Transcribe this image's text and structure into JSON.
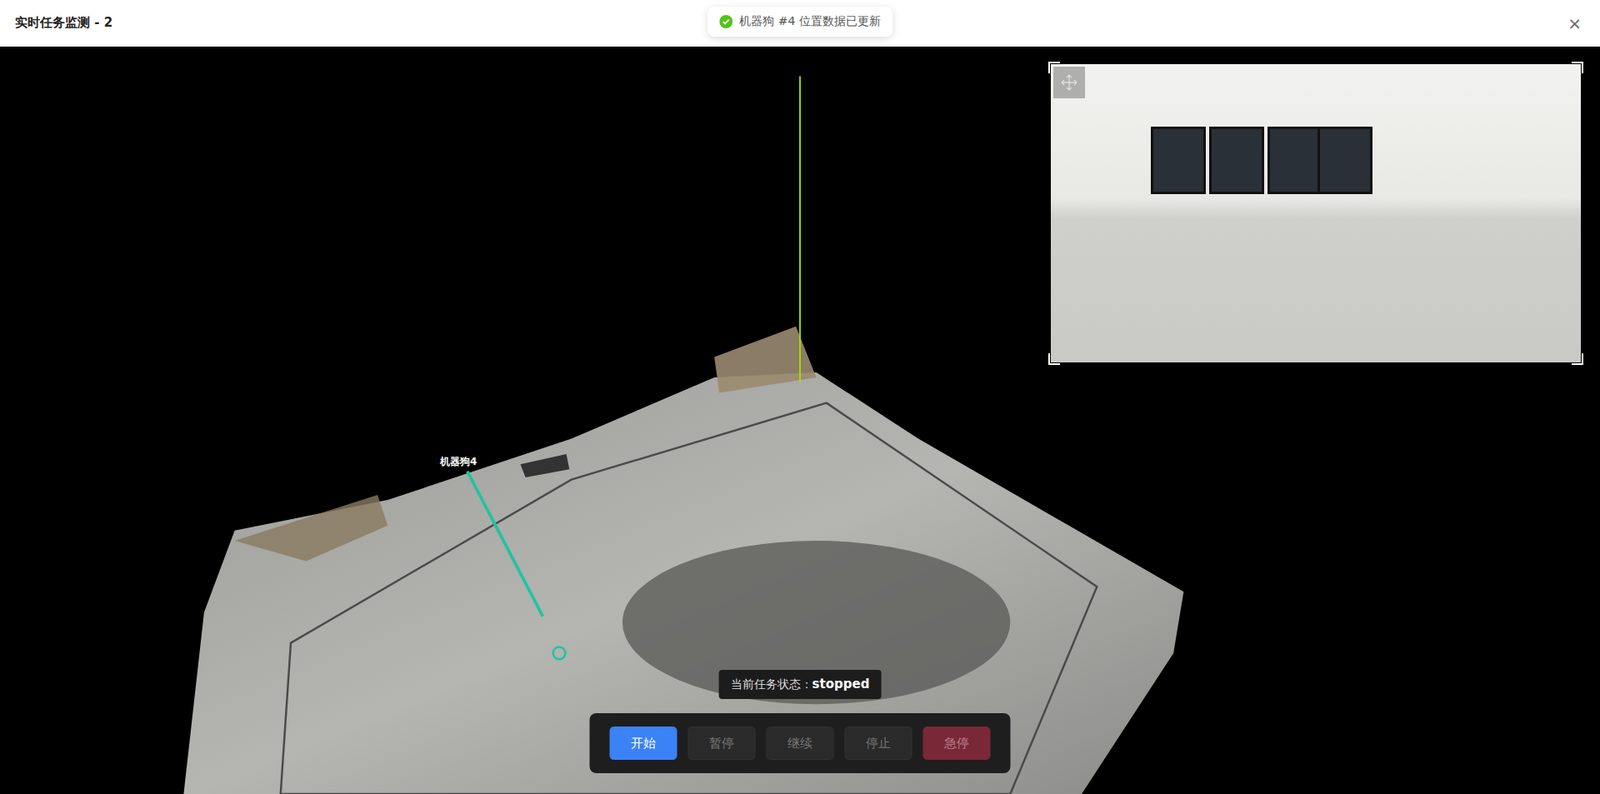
{
  "window": {
    "title": "实时任务监测 - 2",
    "close": "×"
  },
  "toast": {
    "text": "机器狗 #4 位置数据已更新"
  },
  "viewport": {
    "robots": [
      {
        "label": "机器狗4"
      }
    ]
  },
  "status": {
    "label": "当前任务状态：",
    "value": "stopped"
  },
  "buttons": [
    {
      "label": "开始",
      "disabled": false,
      "kind": "primary"
    },
    {
      "label": "暂停",
      "disabled": true,
      "kind": "default"
    },
    {
      "label": "继续",
      "disabled": true,
      "kind": "default"
    },
    {
      "label": "停止",
      "disabled": true,
      "kind": "default"
    },
    {
      "label": "急停",
      "disabled": true,
      "kind": "danger"
    }
  ]
}
